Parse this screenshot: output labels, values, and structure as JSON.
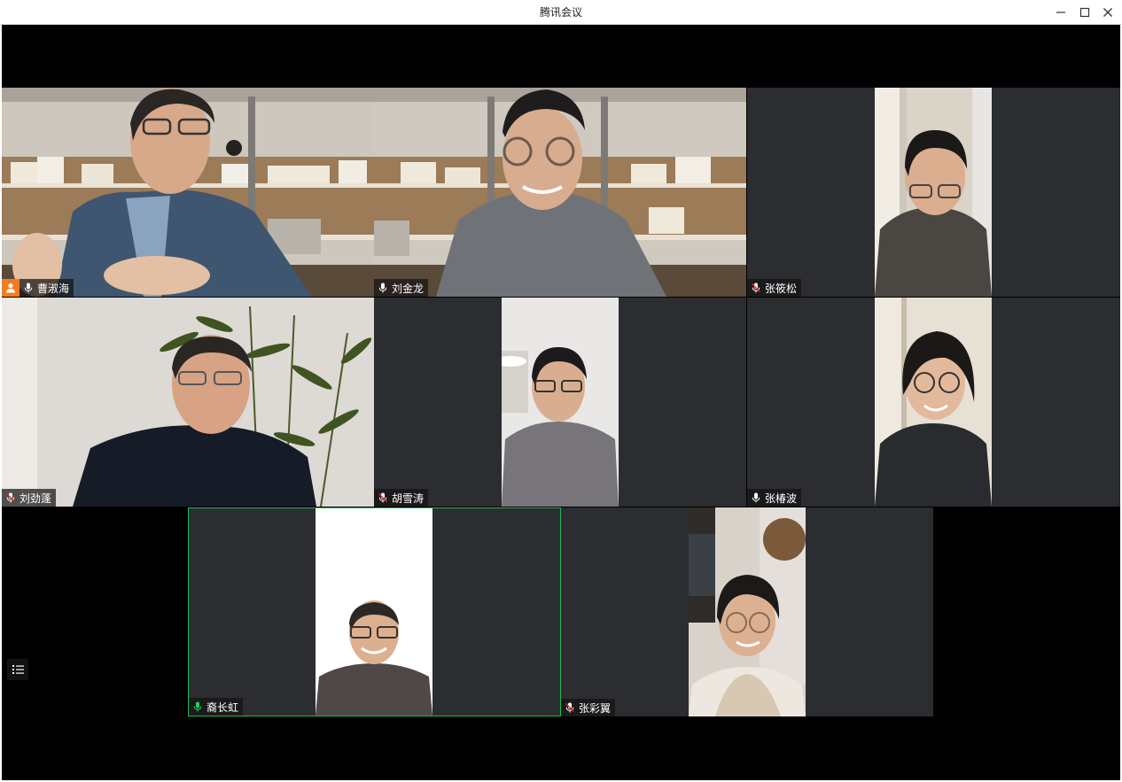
{
  "window": {
    "title": "腾讯会议"
  },
  "participants": [
    {
      "name": "曹淑海",
      "host": true,
      "mic": "on"
    },
    {
      "name": "刘金龙",
      "host": false,
      "mic": "on"
    },
    {
      "name": "张筱松",
      "host": false,
      "mic": "off"
    },
    {
      "name": "刘劲蓬",
      "host": false,
      "mic": "off"
    },
    {
      "name": "胡雪涛",
      "host": false,
      "mic": "off"
    },
    {
      "name": "张椿波",
      "host": false,
      "mic": "on"
    },
    {
      "name": "裔长虹",
      "host": false,
      "mic": "speaking"
    },
    {
      "name": "张彩翼",
      "host": false,
      "mic": "off"
    }
  ],
  "colors": {
    "speaking_border": "#19b955",
    "host_badge": "#f47c20",
    "tile_background": "#2b2d30",
    "stage_background": "#000000"
  },
  "icons": {
    "host": "person-icon",
    "mic_on": "mic-icon",
    "mic_off": "mic-muted-icon",
    "mic_speaking": "mic-speaking-icon",
    "list": "list-icon"
  }
}
